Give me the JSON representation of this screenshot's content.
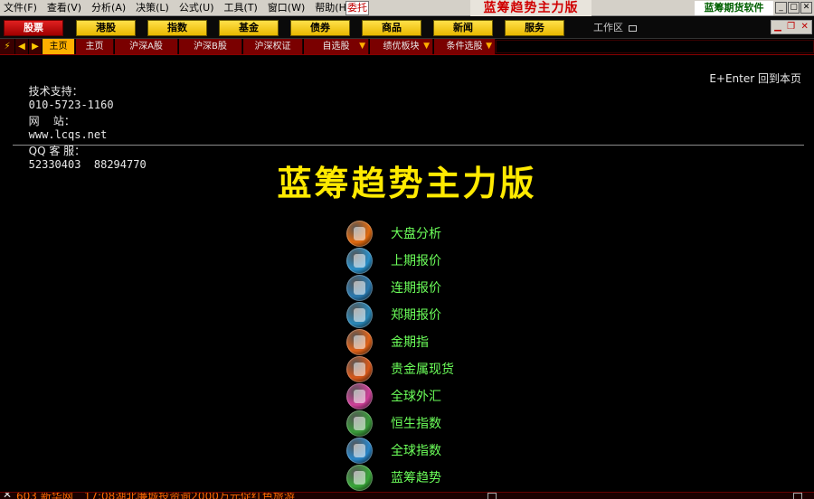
{
  "menubar": {
    "items": [
      "文件(F)",
      "查看(V)",
      "分析(A)",
      "决策(L)",
      "公式(U)",
      "工具(T)",
      "窗口(W)",
      "帮助(H)"
    ],
    "entrust": "委托",
    "brand": "蓝筹趋势主力版",
    "company": "蓝筹期货软件",
    "window_buttons": [
      "_",
      "▢",
      "✕"
    ]
  },
  "categories": [
    {
      "label": "股票",
      "active": true
    },
    {
      "label": "港股",
      "active": false
    },
    {
      "label": "指数",
      "active": false
    },
    {
      "label": "基金",
      "active": false
    },
    {
      "label": "债券",
      "active": false
    },
    {
      "label": "商品",
      "active": false
    },
    {
      "label": "新闻",
      "active": false
    },
    {
      "label": "服务",
      "active": false
    }
  ],
  "workspace": "工作区",
  "inner_window_buttons": [
    "▁",
    "❐",
    "✕"
  ],
  "tabs": [
    {
      "label": "主页",
      "active": true,
      "dropdown": false
    },
    {
      "label": "主页",
      "active": false,
      "dropdown": false
    },
    {
      "label": "沪深A股",
      "active": false,
      "dropdown": false
    },
    {
      "label": "沪深B股",
      "active": false,
      "dropdown": false
    },
    {
      "label": "沪深权证",
      "active": false,
      "dropdown": false
    },
    {
      "label": "自选股",
      "active": false,
      "dropdown": true
    },
    {
      "label": "绩优板块",
      "active": false,
      "dropdown": true
    },
    {
      "label": "条件选股",
      "active": false,
      "dropdown": true
    }
  ],
  "info": {
    "support_label": "技术支持：",
    "support_value": "010-5723-1160",
    "site_label": "网    站：",
    "site_value": "www.lcqs.net",
    "qq_label": "QQ 客 服：",
    "qq_value": "52330403  88294770",
    "back_hint": "E+Enter 回到本页"
  },
  "main_title": "蓝筹趋势主力版",
  "functions": [
    {
      "label": "大盘分析",
      "icon": "market-analysis-icon",
      "color": "#e06a10"
    },
    {
      "label": "上期报价",
      "icon": "monitor-icon",
      "color": "#2a8fc8"
    },
    {
      "label": "连期报价",
      "icon": "dalian-quote-icon",
      "color": "#2a7ab0"
    },
    {
      "label": "郑期报价",
      "icon": "zhengzhou-quote-icon",
      "color": "#2a88b8"
    },
    {
      "label": "金期指",
      "icon": "gold-index-icon",
      "color": "#e0631a"
    },
    {
      "label": "贵金属现货",
      "icon": "precious-metal-icon",
      "color": "#d8581a"
    },
    {
      "label": "全球外汇",
      "icon": "forex-icon",
      "color": "#d0409a"
    },
    {
      "label": "恒生指数",
      "icon": "hang-seng-icon",
      "color": "#3a9a3a"
    },
    {
      "label": "全球指数",
      "icon": "global-index-icon",
      "color": "#2a86c8"
    },
    {
      "label": "蓝筹趋势",
      "icon": "blue-chip-trend-icon",
      "color": "#3aa83a"
    }
  ],
  "ticker": {
    "text": "603 新华网　17:08湖北廉城投资逾2000万元促红色旅游"
  }
}
